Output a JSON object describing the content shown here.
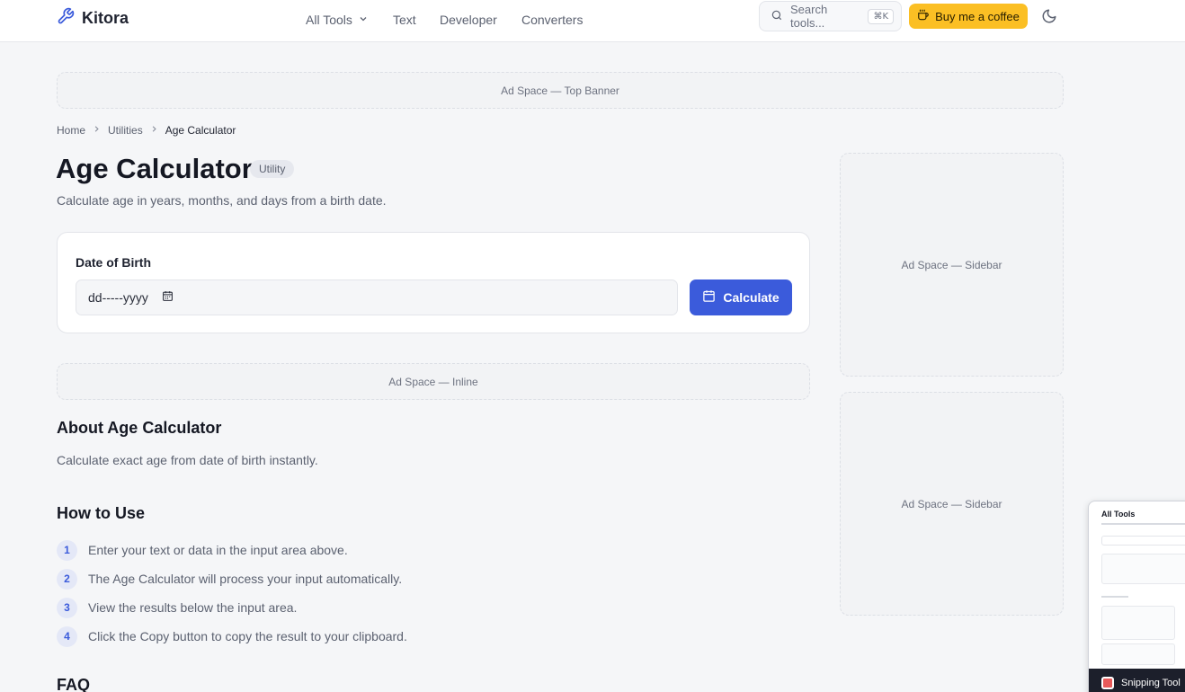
{
  "header": {
    "brand": "Kitora",
    "nav": [
      {
        "label": "All Tools"
      },
      {
        "label": "Text"
      },
      {
        "label": "Developer"
      },
      {
        "label": "Converters"
      }
    ],
    "search_placeholder": "Search tools...",
    "search_shortcut": "⌘K",
    "coffee_label": "Buy me a coffee"
  },
  "ads": {
    "top": "Ad Space — Top Banner",
    "inline": "Ad Space — Inline",
    "sidebar1": "Ad Space — Sidebar",
    "sidebar2": "Ad Space — Sidebar"
  },
  "breadcrumb": [
    "Home",
    "Utilities",
    "Age Calculator"
  ],
  "page": {
    "title": "Age Calculator",
    "badge": "Utility",
    "subtitle": "Calculate age in years, months, and days from a birth date."
  },
  "form": {
    "field_label": "Date of Birth",
    "date_placeholder": "dd-----yyyy",
    "button_label": "Calculate"
  },
  "about": {
    "title": "About Age Calculator",
    "text": "Calculate exact age from date of birth instantly."
  },
  "how_to": {
    "title": "How to Use",
    "steps": [
      {
        "num": "1",
        "text": "Enter your text or data in the input area above."
      },
      {
        "num": "2",
        "text": "The Age Calculator will process your input automatically."
      },
      {
        "num": "3",
        "text": "View the results below the input area."
      },
      {
        "num": "4",
        "text": "Click the Copy button to copy the result to your clipboard."
      }
    ]
  },
  "faq": {
    "title": "FAQ"
  },
  "snip_preview": {
    "title": "All Tools",
    "app_label": "Snipping Tool"
  },
  "colors": {
    "accent": "#3b5bdb",
    "coffee": "#fbbf24"
  }
}
